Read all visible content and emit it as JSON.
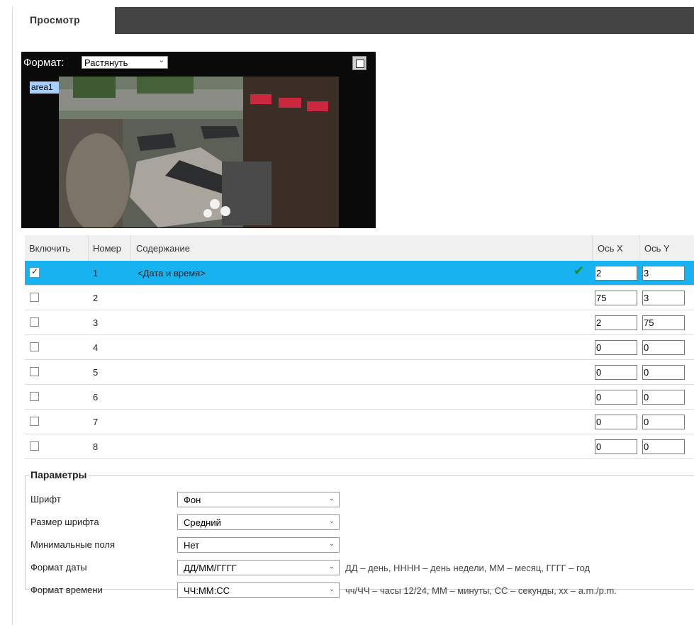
{
  "tab": {
    "label": "Просмотр"
  },
  "preview": {
    "format_label": "Формат:",
    "format_value": "Растянуть",
    "area_label": "area1",
    "fullscreen_icon": "fullscreen-icon"
  },
  "table": {
    "headers": [
      "Включить",
      "Номер",
      "Содержание",
      "Ось X",
      "Ось Y"
    ],
    "rows": [
      {
        "enabled": true,
        "number": "1",
        "content": "<Дата и время>",
        "x": "2",
        "y": "3"
      },
      {
        "enabled": false,
        "number": "2",
        "content": "",
        "x": "75",
        "y": "3"
      },
      {
        "enabled": false,
        "number": "3",
        "content": "",
        "x": "2",
        "y": "75"
      },
      {
        "enabled": false,
        "number": "4",
        "content": "",
        "x": "0",
        "y": "0"
      },
      {
        "enabled": false,
        "number": "5",
        "content": "",
        "x": "0",
        "y": "0"
      },
      {
        "enabled": false,
        "number": "6",
        "content": "",
        "x": "0",
        "y": "0"
      },
      {
        "enabled": false,
        "number": "7",
        "content": "",
        "x": "0",
        "y": "0"
      },
      {
        "enabled": false,
        "number": "8",
        "content": "",
        "x": "0",
        "y": "0"
      }
    ],
    "selected_color": "#18b2f0"
  },
  "params": {
    "title": "Параметры",
    "items": [
      {
        "label": "Шрифт",
        "value": "Фон",
        "hint": ""
      },
      {
        "label": "Размер шрифта",
        "value": "Средний",
        "hint": ""
      },
      {
        "label": "Минимальные поля",
        "value": "Нет",
        "hint": ""
      },
      {
        "label": "Формат даты",
        "value": "ДД/ММ/ГГГГ",
        "hint": "ДД – день, НННН – день недели, ММ – месяц, ГГГГ – год"
      },
      {
        "label": "Формат времени",
        "value": "ЧЧ:ММ:СС",
        "hint": "чч/ЧЧ – часы 12/24, ММ – минуты, СС – секунды, хх – a.m./p.m."
      }
    ]
  }
}
